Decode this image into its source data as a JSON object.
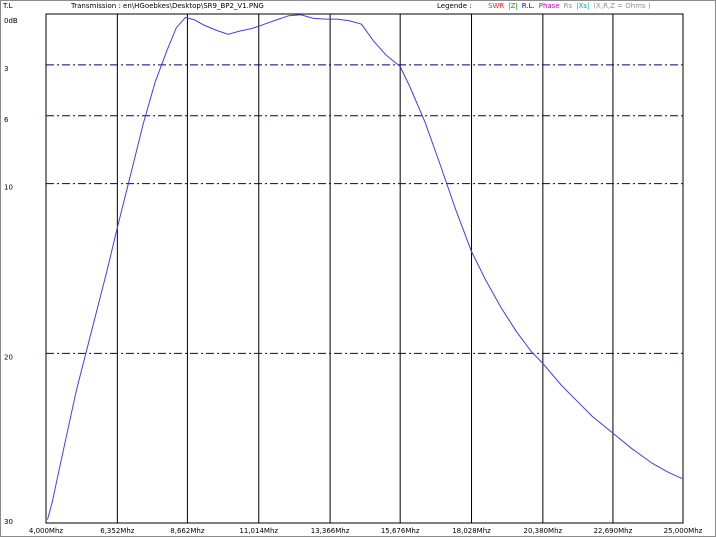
{
  "header": {
    "mode": "T.L",
    "file_label": "Transmission : en\\HGoebkes\\Desktop\\SR9_BP2_V1.PNG",
    "legend_label": "Legende :",
    "legend_items": [
      {
        "label": "SWR",
        "color": "#ff2020"
      },
      {
        "label": "|Z|",
        "color": "#00a000"
      },
      {
        "label": "R.L.",
        "color": "#0000ff"
      },
      {
        "label": "Phase",
        "color": "#c000c0"
      },
      {
        "label": "Rs",
        "color": "#909090"
      },
      {
        "label": "|Xs|",
        "color": "#00a0a0"
      },
      {
        "label": "(X,R,Z = Ohms )",
        "color": "#909090"
      }
    ]
  },
  "chart_data": {
    "type": "line",
    "title": "Transmission",
    "ylabel": "dB",
    "y_inverted": true,
    "ylim": [
      0,
      30
    ],
    "xlim": [
      4.0,
      25.0
    ],
    "y_tick_labels": [
      {
        "value": 0,
        "label": "0dB"
      },
      {
        "value": 3,
        "label": "3"
      },
      {
        "value": 6,
        "label": "6"
      },
      {
        "value": 10,
        "label": "10"
      },
      {
        "value": 20,
        "label": "20"
      },
      {
        "value": 30,
        "label": "30"
      }
    ],
    "y_gridlines": [
      3,
      6,
      10,
      20
    ],
    "x_ticks": [
      4.0,
      6.352,
      8.662,
      11.014,
      13.366,
      15.676,
      18.028,
      20.38,
      22.69,
      25.0
    ],
    "x_tick_labels": [
      "4,000Mhz",
      "6,352Mhz",
      "8,662Mhz",
      "11,014Mhz",
      "13,366Mhz",
      "15,676Mhz",
      "18,028Mhz",
      "20,380Mhz",
      "22,690Mhz",
      "25,000Mhz"
    ],
    "grid": true,
    "colors": {
      "line": "#4040e0",
      "grid": "#000000",
      "grid_dash": "#000080",
      "frame": "#8a8a8a"
    },
    "series": [
      {
        "x": [
          4.05,
          4.2,
          4.5,
          5.0,
          5.5,
          6.0,
          6.352,
          6.8,
          7.2,
          7.6,
          8.0,
          8.3,
          8.6,
          8.9,
          9.2,
          9.6,
          10.0,
          10.4,
          10.8,
          11.2,
          11.6,
          12.0,
          12.4,
          12.8,
          13.2,
          13.6,
          14.0,
          14.4,
          14.8,
          15.2,
          15.676,
          16.0,
          16.5,
          17.0,
          17.5,
          18.028,
          18.5,
          19.0,
          19.5,
          20.0,
          20.38,
          21.0,
          21.5,
          22.0,
          22.69,
          23.3,
          24.0,
          24.5,
          25.0
        ],
        "y": [
          29.8,
          28.8,
          26.3,
          22.2,
          18.7,
          15.2,
          12.6,
          9.4,
          6.5,
          4.0,
          2.1,
          0.8,
          0.2,
          0.35,
          0.65,
          0.95,
          1.2,
          1.0,
          0.85,
          0.6,
          0.35,
          0.1,
          0.05,
          0.25,
          0.3,
          0.3,
          0.4,
          0.6,
          1.6,
          2.4,
          3.1,
          4.3,
          6.4,
          8.9,
          11.5,
          14.0,
          15.7,
          17.3,
          18.7,
          19.9,
          20.6,
          21.9,
          22.8,
          23.7,
          24.7,
          25.6,
          26.5,
          27.0,
          27.4
        ]
      }
    ]
  }
}
